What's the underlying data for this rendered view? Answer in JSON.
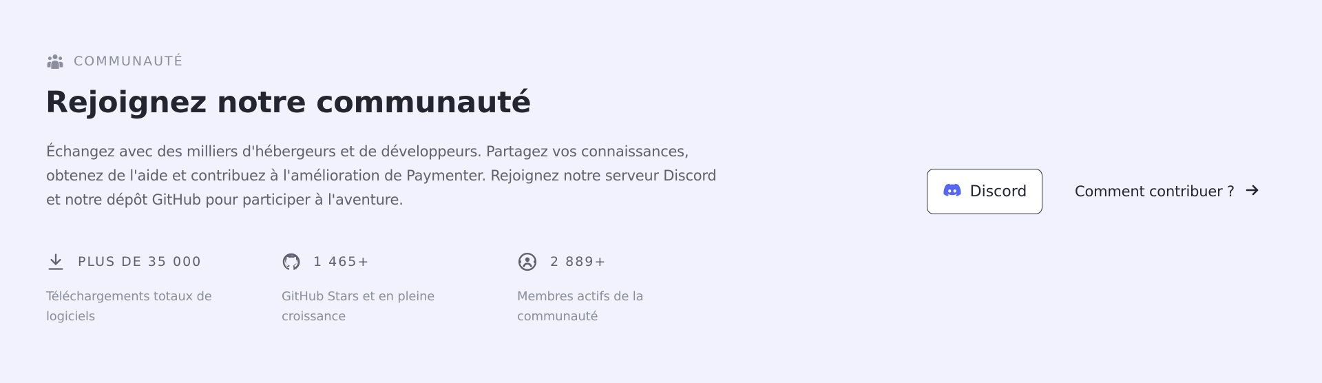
{
  "eyebrow": {
    "icon": "users-icon",
    "label": "COMMUNAUTÉ"
  },
  "title": "Rejoignez notre communauté",
  "description": "Échangez avec des milliers d'hébergeurs et de développeurs. Partagez vos connaissances, obtenez de l'aide et contribuez à l'amélioration de Paymenter. Rejoignez notre serveur Discord et notre dépôt GitHub pour participer à l'aventure.",
  "stats": [
    {
      "icon": "download-icon",
      "value": "PLUS DE 35 000",
      "description": "Téléchargements totaux de logiciels"
    },
    {
      "icon": "github-icon",
      "value": "1 465+",
      "description": "GitHub Stars et en pleine croissance"
    },
    {
      "icon": "community-icon",
      "value": "2 889+",
      "description": "Membres actifs de la communauté"
    }
  ],
  "actions": {
    "discord_label": "Discord",
    "contribute_label": "Comment contribuer ?"
  },
  "colors": {
    "background": "#f1f2fd",
    "discord_brand": "#5865f2",
    "heading": "#232530",
    "muted": "#8b8e9e"
  }
}
